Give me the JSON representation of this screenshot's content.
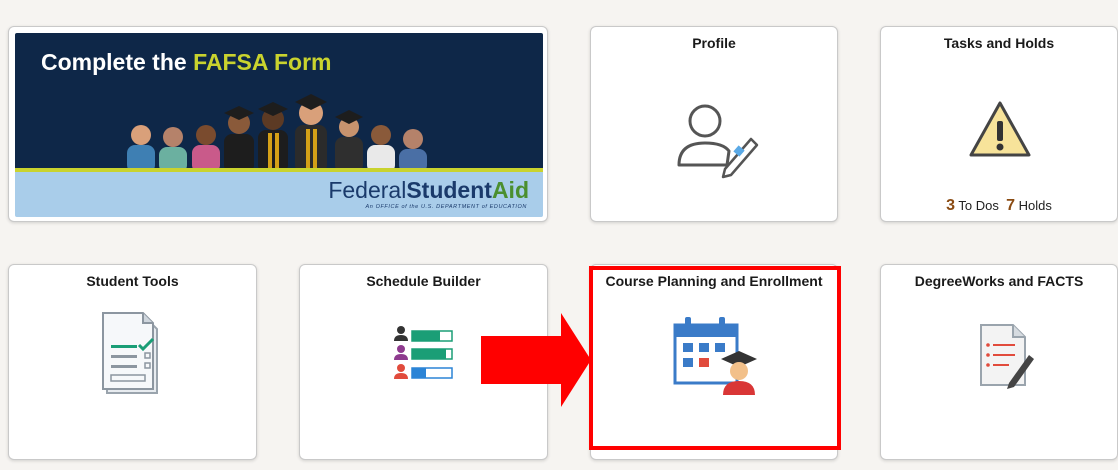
{
  "banner": {
    "headline_white": "Complete the",
    "headline_highlight": "FAFSA Form",
    "logo_federal": "Federal",
    "logo_student": "Student",
    "logo_aid": "Aid",
    "logo_subtitle": "An OFFICE of the U.S. DEPARTMENT of EDUCATION"
  },
  "tiles": {
    "profile": {
      "title": "Profile",
      "icon": "profile-edit-icon"
    },
    "tasks_holds": {
      "title": "Tasks and Holds",
      "icon": "warning-icon",
      "todos_count": "3",
      "todos_label": "To Dos",
      "holds_count": "7",
      "holds_label": "Holds"
    },
    "student_tools": {
      "title": "Student Tools",
      "icon": "checklist-clipboard-icon"
    },
    "schedule_builder": {
      "title": "Schedule Builder",
      "icon": "schedule-builder-icon"
    },
    "course_planning": {
      "title": "Course Planning and Enrollment",
      "icon": "calendar-graduate-icon"
    },
    "degreeworks": {
      "title": "DegreeWorks and FACTS",
      "icon": "document-pen-icon"
    }
  },
  "colors": {
    "banner_dark": "#0e2748",
    "banner_accent": "#c9d32e",
    "banner_light": "#a9cdea",
    "annotation_red": "#ff0000",
    "count_color": "#8a4b12"
  }
}
